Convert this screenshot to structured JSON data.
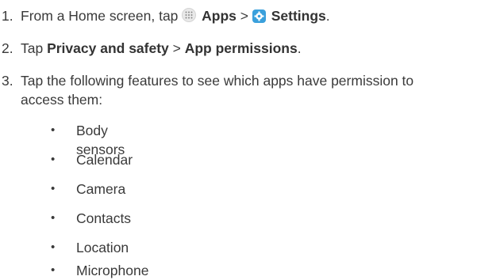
{
  "steps": [
    {
      "number": "1.",
      "pre": "From a Home screen, tap ",
      "apps_label": "Apps",
      "sep": " > ",
      "settings_label": "Settings",
      "end": "."
    },
    {
      "number": "2.",
      "pre": "Tap ",
      "a": "Privacy and safety",
      "sep": " > ",
      "b": "App permissions",
      "end": "."
    },
    {
      "number": "3.",
      "line1": "Tap the following features to see which apps have permission to",
      "line2": "access them:"
    }
  ],
  "bullet_char": "•",
  "features": [
    "Body sensors",
    "Calendar",
    "Camera",
    "Contacts",
    "Location",
    "Microphone"
  ]
}
